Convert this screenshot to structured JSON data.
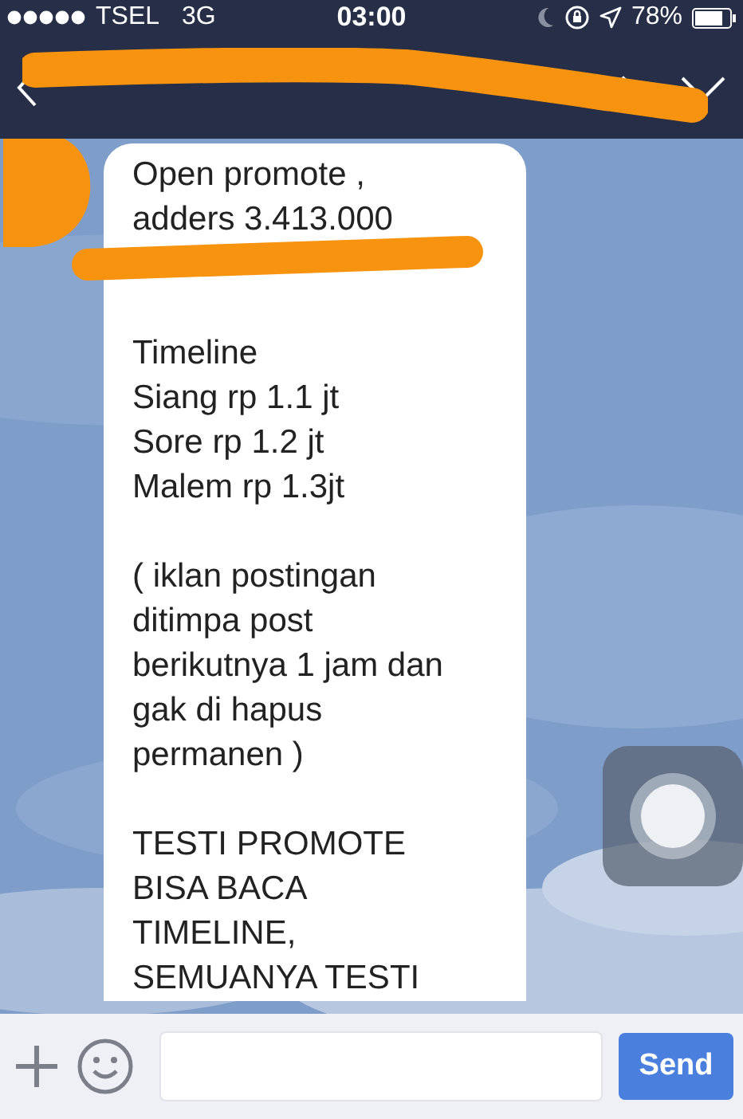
{
  "status_bar": {
    "carrier": "TSEL",
    "network": "3G",
    "time": "03:00",
    "battery": "78%"
  },
  "message": {
    "paragraphs": [
      {
        "lines": [
          "Open promote ,",
          "adders 3.413.000"
        ]
      },
      {
        "lines": [
          "Timeline",
          "Siang rp 1.1 jt",
          "Sore rp 1.2 jt",
          "Malem rp 1.3jt"
        ]
      },
      {
        "lines": [
          "( iklan postingan",
          "ditimpa post",
          "berikutnya 1 jam dan",
          "gak di hapus",
          "permanen )"
        ]
      },
      {
        "lines": [
          "TESTI PROMOTE",
          "BISA BACA",
          "TIMELINE,",
          "SEMUANYA TESTI"
        ]
      }
    ]
  },
  "composer": {
    "send_label": "Send"
  }
}
